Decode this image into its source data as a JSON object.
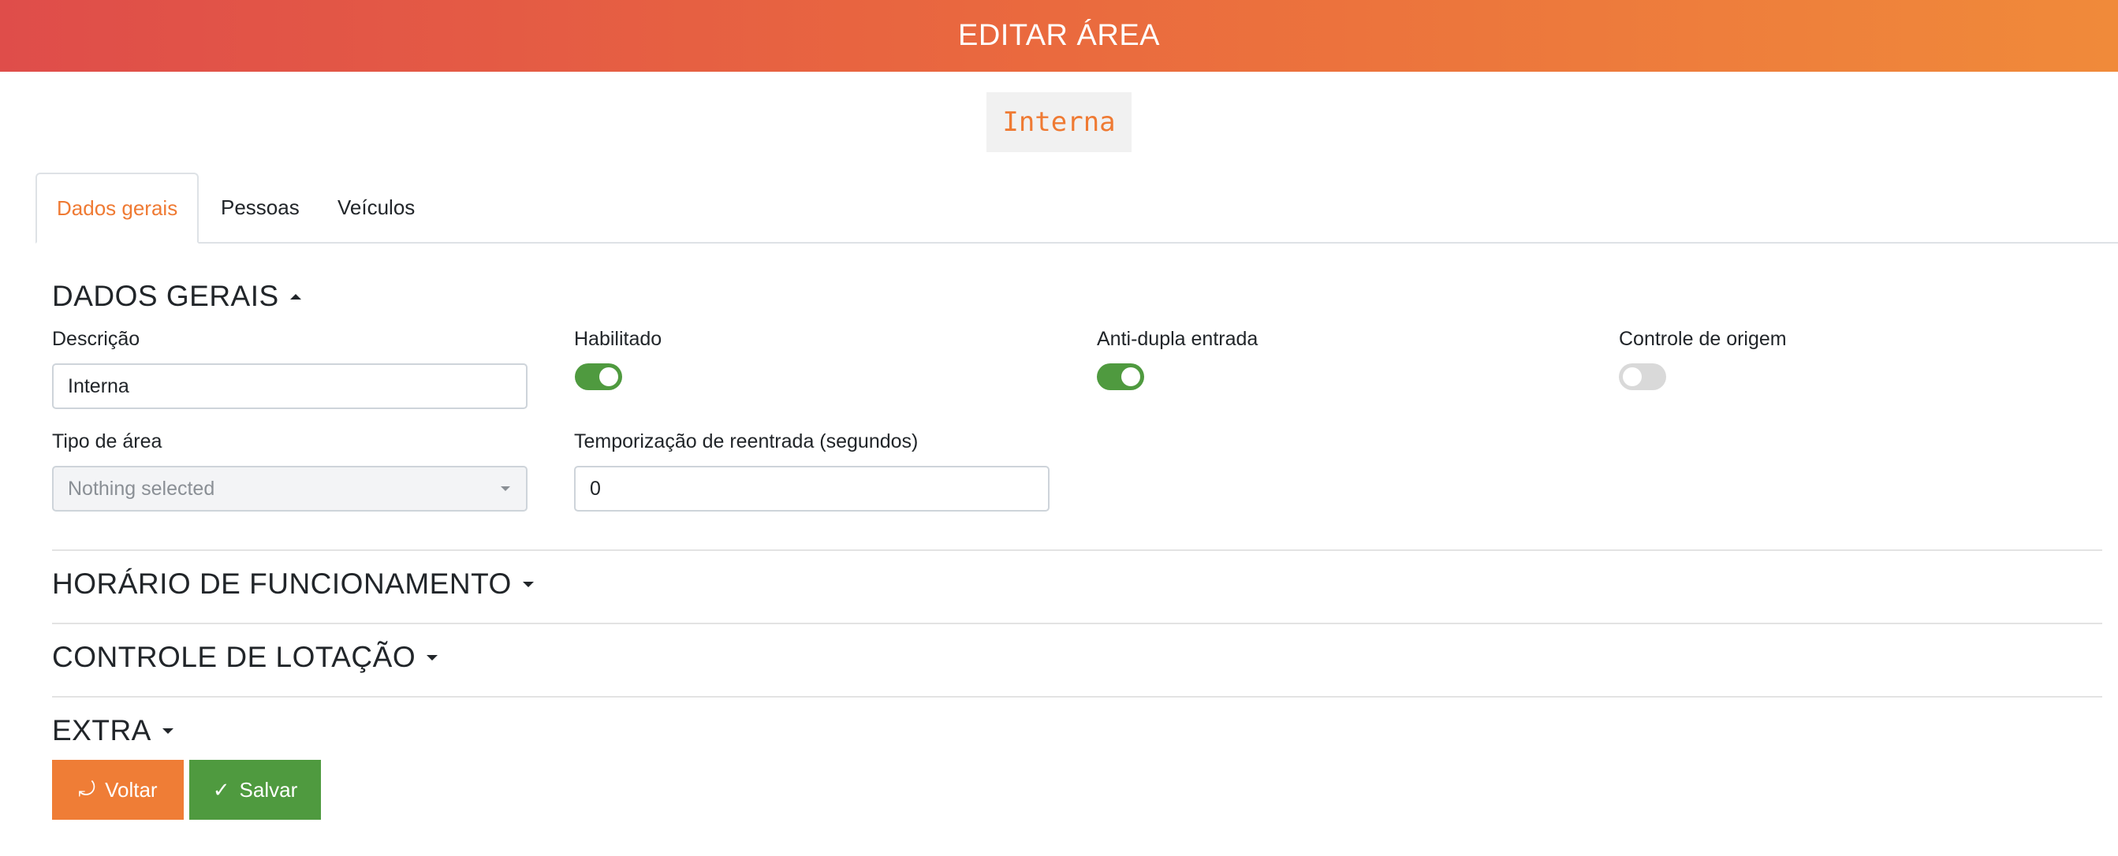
{
  "header": {
    "title": "EDITAR ÁREA"
  },
  "area_badge": "Interna",
  "tabs": [
    {
      "label": "Dados gerais",
      "active": true
    },
    {
      "label": "Pessoas",
      "active": false
    },
    {
      "label": "Veículos",
      "active": false
    }
  ],
  "sections": {
    "dados_gerais": "DADOS GERAIS",
    "horario": "HORÁRIO DE FUNCIONAMENTO",
    "lotacao": "CONTROLE DE LOTAÇÃO",
    "extra": "EXTRA"
  },
  "form": {
    "descricao_label": "Descrição",
    "descricao_value": "Interna",
    "habilitado_label": "Habilitado",
    "habilitado_on": true,
    "anti_dupla_label": "Anti-dupla entrada",
    "anti_dupla_on": true,
    "controle_origem_label": "Controle de origem",
    "controle_origem_on": false,
    "tipo_area_label": "Tipo de área",
    "tipo_area_value": "Nothing selected",
    "temporizacao_label": "Temporização de reentrada (segundos)",
    "temporizacao_value": "0"
  },
  "buttons": {
    "back_label": "Voltar",
    "back_icon": "return-arrow-icon",
    "save_label": "Salvar",
    "save_icon": "check-icon"
  },
  "colors": {
    "header_start": "#df4d4a",
    "header_end": "#f08a3a",
    "accent_orange": "#ef7a33",
    "toggle_green": "#4f9a3f"
  }
}
